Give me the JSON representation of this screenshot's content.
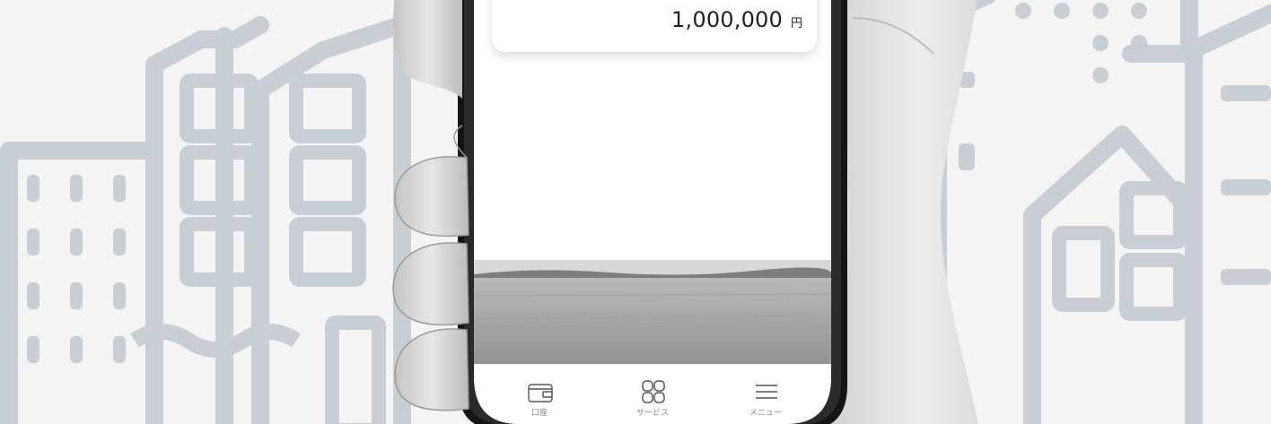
{
  "balance": {
    "amount": "1,000,000",
    "currency": "円"
  },
  "tabbar": {
    "items": [
      {
        "label": "口座",
        "icon": "wallet-icon"
      },
      {
        "label": "サービス",
        "icon": "grid-icon"
      },
      {
        "label": "メニュー",
        "icon": "hamburger-menu-icon"
      }
    ]
  },
  "colors": {
    "background": "#f4f4f4",
    "building_illustration": "#c8cdd3",
    "phone_frame": "#141414"
  }
}
